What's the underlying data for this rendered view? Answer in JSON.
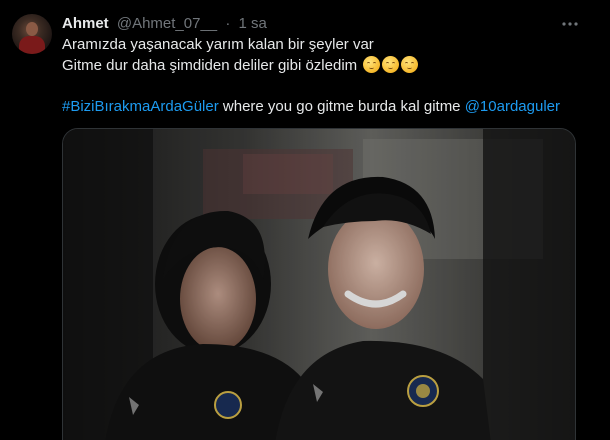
{
  "tweet": {
    "author_name": "Ahmet",
    "author_handle": "@Ahmet_07__",
    "separator": "·",
    "time": "1 sa",
    "line1": "Aramızda yaşanacak yarım kalan bir şeyler var",
    "line2": "Gitme dur daha şimdiden deliler gibi özledim",
    "emoji_count": 3,
    "hashtag": "#BiziBırakmaArdaGüler",
    "line3_middle": " where you go gitme burda kal gitme ",
    "mention": "@10ardaguler"
  },
  "icons": {
    "more": "more-horizontal-icon",
    "emoji": "relieved-face-emoji"
  },
  "colors": {
    "background": "#000000",
    "text": "#e7e9ea",
    "muted": "#71767b",
    "link": "#1d9bf0"
  }
}
